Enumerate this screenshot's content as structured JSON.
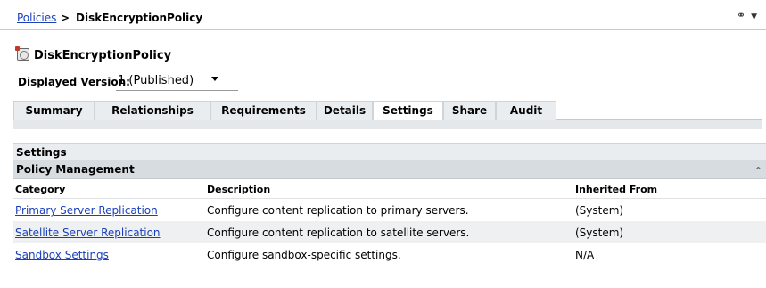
{
  "breadcrumb": {
    "root": "Policies",
    "separator": ">",
    "current": "DiskEncryptionPolicy"
  },
  "top_icons": {
    "link_icon": "link-icon",
    "menu_icon": "chevron-down-icon"
  },
  "title": "DiskEncryptionPolicy",
  "version": {
    "label": "Displayed Version:",
    "value": "1 (Published)"
  },
  "tabs": [
    {
      "label": "Summary",
      "active": false
    },
    {
      "label": "Relationships",
      "active": false
    },
    {
      "label": "Requirements",
      "active": false
    },
    {
      "label": "Details",
      "active": false
    },
    {
      "label": "Settings",
      "active": true
    },
    {
      "label": "Share",
      "active": false
    },
    {
      "label": "Audit",
      "active": false
    }
  ],
  "settings": {
    "header": "Settings",
    "subheader": "Policy Management",
    "columns": {
      "category": "Category",
      "description": "Description",
      "inherited": "Inherited From"
    },
    "rows": [
      {
        "category": "Primary Server Replication",
        "description": "Configure content replication to primary servers.",
        "inherited": "(System)"
      },
      {
        "category": "Satellite Server Replication",
        "description": "Configure content replication to satellite servers.",
        "inherited": "(System)"
      },
      {
        "category": "Sandbox Settings",
        "description": "Configure sandbox-specific settings.",
        "inherited": "N/A"
      }
    ]
  },
  "colors": {
    "link": "#1a3fb8",
    "tab_bg": "#e9edf0",
    "header_bg": "#d7dce0",
    "alt_row": "#eef0f2"
  }
}
